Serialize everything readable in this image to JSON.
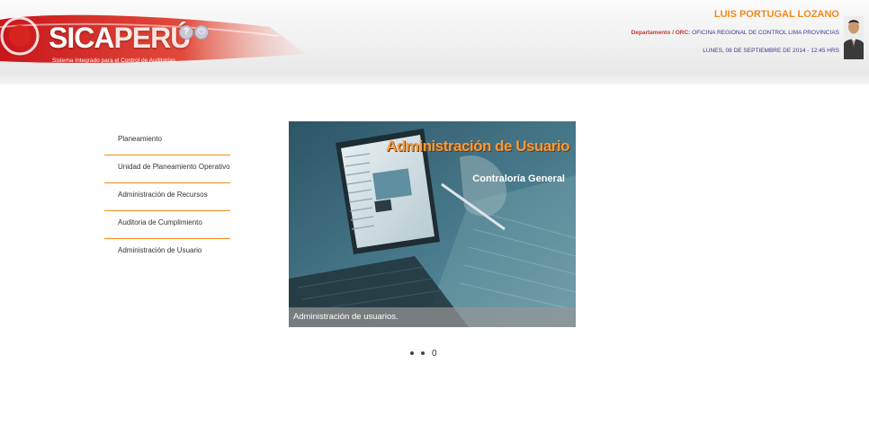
{
  "header": {
    "logo_main": "SICA",
    "logo_accent": "PERÚ",
    "logo_subtitle": "Sistema Integrado para el Control de Auditorías",
    "help_icon": "question-circle-icon",
    "power_icon": "power-icon",
    "user_name": "LUIS PORTUGAL LOZANO",
    "department_label": "Departamento / ORC:",
    "department_value": "OFICINA REGIONAL DE CONTROL LIMA PROVINCIAS",
    "date": "LUNES, 08 DE SEPTIEMBRE DE 2014 - 12:45 HRS"
  },
  "menu": {
    "items": [
      {
        "label": "Planeamiento"
      },
      {
        "label": "Unidad de Planeamiento Operativo"
      },
      {
        "label": "Administración de Recursos"
      },
      {
        "label": "Auditoria de Cumplimiento"
      },
      {
        "label": "Administración de Usuario"
      }
    ]
  },
  "banner": {
    "title": "Administración de Usuario",
    "subtitle": "Contraloría General",
    "caption": "Administración de usuarios."
  },
  "pager": {
    "active_label": "0"
  },
  "colors": {
    "accent": "#f28a1a",
    "brand_red": "#d8251d",
    "text_blue": "#3a3a8c"
  }
}
